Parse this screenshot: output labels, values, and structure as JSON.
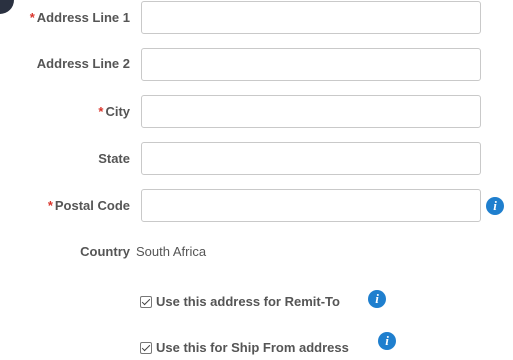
{
  "form": {
    "address_line1": {
      "label": "Address Line 1",
      "required": "*",
      "value": ""
    },
    "address_line2": {
      "label": "Address Line 2",
      "value": ""
    },
    "city": {
      "label": "City",
      "required": "*",
      "value": ""
    },
    "state": {
      "label": "State",
      "value": ""
    },
    "postal_code": {
      "label": "Postal Code",
      "required": "*",
      "value": "",
      "info_icon": "info-icon"
    },
    "country": {
      "label": "Country",
      "value": "South Africa"
    },
    "remit_to": {
      "label": "Use this address for Remit-To",
      "checked": true,
      "info_icon": "info-icon"
    },
    "ship_from": {
      "label": "Use this for Ship From address",
      "checked": true,
      "info_icon": "info-icon"
    }
  },
  "colors": {
    "required": "#d9342b",
    "info": "#1f7fce",
    "border": "#c9c9c9"
  }
}
